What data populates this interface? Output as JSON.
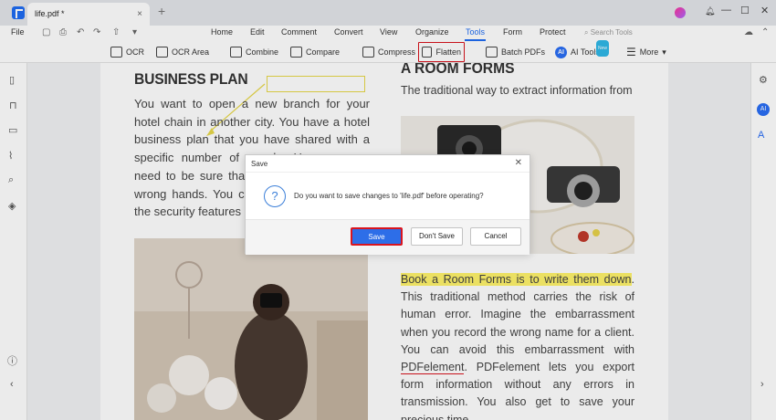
{
  "window": {
    "tab_title": "life.pdf *",
    "tab_close": "×",
    "tab_add": "+",
    "min": "—",
    "max": "☐",
    "close": "✕"
  },
  "menu": {
    "file": "File",
    "items": [
      "Home",
      "Edit",
      "Comment",
      "Convert",
      "View",
      "Organize",
      "Tools",
      "Form",
      "Protect"
    ],
    "active": "Tools",
    "search_placeholder": "Search Tools"
  },
  "toolbar": {
    "ocr": "OCR",
    "ocr_area": "OCR Area",
    "combine": "Combine",
    "compare": "Compare",
    "compress": "Compress",
    "flatten": "Flatten",
    "batch": "Batch PDFs",
    "ai_tools": "AI Tools",
    "ai_badge": "AI",
    "new_badge": "New",
    "more": "More"
  },
  "document": {
    "left_heading": "BUSINESS PLAN",
    "left_body": "You want to open a new branch for your hotel chain in another city. You have a hotel business plan that you have shared with a specific number of people. However, you need to be sure that it doesn't fall into the wrong hands. You can easily do this using the security features of PDFelement.",
    "right_heading": "A ROOM FORMS",
    "right_sub": "The traditional way to extract information from",
    "right_highlight": "Book a Room Forms is to write them down",
    "right_body_1": ". This traditional method carries the risk of human error. Imagine the embarrassment when you record the wrong name for a client. You can avoid this embarrassment with",
    "right_underline": " PDFelement",
    "right_body_2": ". PDFelement lets you export form information without any errors in transmission. You also get to save your precious time."
  },
  "dialog": {
    "title": "Save",
    "close": "✕",
    "icon": "?",
    "message": "Do you want to save changes to 'life.pdf' before operating?",
    "save": "Save",
    "dont_save": "Don't Save",
    "cancel": "Cancel"
  },
  "colors": {
    "accent": "#1f6cf2",
    "highlight_border": "#d9141e",
    "text_highlight": "#fff36b"
  }
}
